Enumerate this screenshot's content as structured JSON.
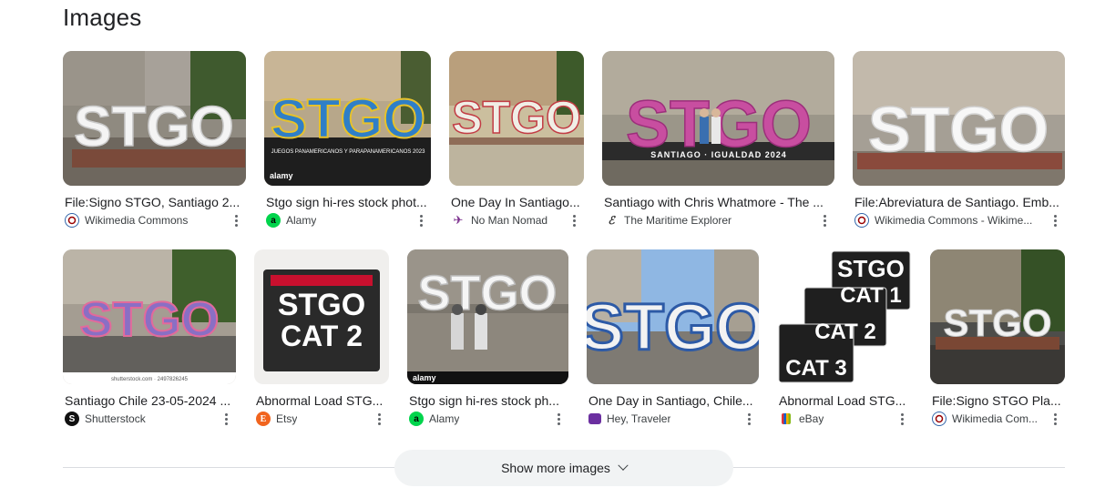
{
  "section": {
    "title": "Images"
  },
  "colors": {
    "accent": "#1a73e8",
    "text": "#202124",
    "muted": "#3c4043",
    "button_bg": "#f1f3f4"
  },
  "results_row1": [
    {
      "caption": "File:Signo STGO, Santiago 2...",
      "source": "Wikimedia Commons",
      "favicon": "wikimedia-icon",
      "image_text": "STGO"
    },
    {
      "caption": "Stgo sign hi-res stock phot...",
      "source": "Alamy",
      "favicon": "alamy-icon",
      "image_text": "STGO",
      "image_subtext": "JUEGOS PANAMERICANOS Y PARAPANAMERICANOS 2023",
      "watermark": "alamy"
    },
    {
      "caption": "One Day In Santiago...",
      "source": "No Man Nomad",
      "favicon": "plane-icon",
      "image_text": "STGO"
    },
    {
      "caption": "Santiago with Chris Whatmore - The ...",
      "source": "The Maritime Explorer",
      "favicon": "maritime-icon",
      "image_text": "STGO",
      "image_subtext": "SANTIAGO · IGUALDAD 2024"
    },
    {
      "caption": "File:Abreviatura de Santiago. Emb...",
      "source": "Wikimedia Commons - Wikime...",
      "favicon": "wikimedia-icon",
      "image_text": "STGO"
    }
  ],
  "results_row2": [
    {
      "caption": "Santiago Chile 23-05-2024 ...",
      "source": "Shutterstock",
      "favicon": "shutterstock-icon",
      "image_text": "STGO",
      "image_subtext": "shutterstock.com · 2497826245"
    },
    {
      "caption": "Abnormal Load STG...",
      "source": "Etsy",
      "favicon": "etsy-icon",
      "image_text": "STGO",
      "image_subtext": "CAT 2"
    },
    {
      "caption": "Stgo sign hi-res stock ph...",
      "source": "Alamy",
      "favicon": "alamy-icon",
      "image_text": "STGO",
      "watermark": "alamy"
    },
    {
      "caption": "One Day in Santiago, Chile...",
      "source": "Hey, Traveler",
      "favicon": "suitcase-icon",
      "image_text": "STGO"
    },
    {
      "caption": "Abnormal Load STG...",
      "source": "eBay",
      "favicon": "ebay-icon",
      "image_text": "STGO",
      "image_subtext": [
        "CAT 1",
        "CAT 2",
        "CAT 3"
      ]
    },
    {
      "caption": "File:Signo STGO Pla...",
      "source": "Wikimedia Com...",
      "favicon": "wikimedia-icon",
      "image_text": "STGO"
    }
  ],
  "footer": {
    "show_more_label": "Show more images"
  }
}
